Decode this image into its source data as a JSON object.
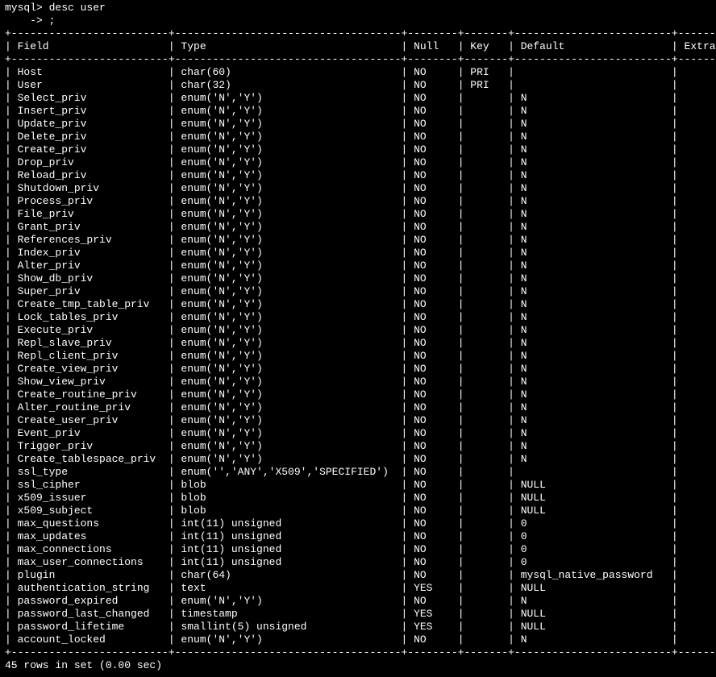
{
  "prompt1": "mysql> desc user",
  "prompt2": "    -> ;",
  "headers": [
    "Field",
    "Type",
    "Null",
    "Key",
    "Default",
    "Extra"
  ],
  "widths": [
    23,
    34,
    6,
    5,
    23,
    7
  ],
  "rows": [
    {
      "f": "Host",
      "t": "char(60)",
      "n": "NO",
      "k": "PRI",
      "d": "",
      "e": ""
    },
    {
      "f": "User",
      "t": "char(32)",
      "n": "NO",
      "k": "PRI",
      "d": "",
      "e": ""
    },
    {
      "f": "Select_priv",
      "t": "enum('N','Y')",
      "n": "NO",
      "k": "",
      "d": "N",
      "e": ""
    },
    {
      "f": "Insert_priv",
      "t": "enum('N','Y')",
      "n": "NO",
      "k": "",
      "d": "N",
      "e": ""
    },
    {
      "f": "Update_priv",
      "t": "enum('N','Y')",
      "n": "NO",
      "k": "",
      "d": "N",
      "e": ""
    },
    {
      "f": "Delete_priv",
      "t": "enum('N','Y')",
      "n": "NO",
      "k": "",
      "d": "N",
      "e": ""
    },
    {
      "f": "Create_priv",
      "t": "enum('N','Y')",
      "n": "NO",
      "k": "",
      "d": "N",
      "e": ""
    },
    {
      "f": "Drop_priv",
      "t": "enum('N','Y')",
      "n": "NO",
      "k": "",
      "d": "N",
      "e": ""
    },
    {
      "f": "Reload_priv",
      "t": "enum('N','Y')",
      "n": "NO",
      "k": "",
      "d": "N",
      "e": ""
    },
    {
      "f": "Shutdown_priv",
      "t": "enum('N','Y')",
      "n": "NO",
      "k": "",
      "d": "N",
      "e": ""
    },
    {
      "f": "Process_priv",
      "t": "enum('N','Y')",
      "n": "NO",
      "k": "",
      "d": "N",
      "e": ""
    },
    {
      "f": "File_priv",
      "t": "enum('N','Y')",
      "n": "NO",
      "k": "",
      "d": "N",
      "e": ""
    },
    {
      "f": "Grant_priv",
      "t": "enum('N','Y')",
      "n": "NO",
      "k": "",
      "d": "N",
      "e": ""
    },
    {
      "f": "References_priv",
      "t": "enum('N','Y')",
      "n": "NO",
      "k": "",
      "d": "N",
      "e": ""
    },
    {
      "f": "Index_priv",
      "t": "enum('N','Y')",
      "n": "NO",
      "k": "",
      "d": "N",
      "e": ""
    },
    {
      "f": "Alter_priv",
      "t": "enum('N','Y')",
      "n": "NO",
      "k": "",
      "d": "N",
      "e": ""
    },
    {
      "f": "Show_db_priv",
      "t": "enum('N','Y')",
      "n": "NO",
      "k": "",
      "d": "N",
      "e": ""
    },
    {
      "f": "Super_priv",
      "t": "enum('N','Y')",
      "n": "NO",
      "k": "",
      "d": "N",
      "e": ""
    },
    {
      "f": "Create_tmp_table_priv",
      "t": "enum('N','Y')",
      "n": "NO",
      "k": "",
      "d": "N",
      "e": ""
    },
    {
      "f": "Lock_tables_priv",
      "t": "enum('N','Y')",
      "n": "NO",
      "k": "",
      "d": "N",
      "e": ""
    },
    {
      "f": "Execute_priv",
      "t": "enum('N','Y')",
      "n": "NO",
      "k": "",
      "d": "N",
      "e": ""
    },
    {
      "f": "Repl_slave_priv",
      "t": "enum('N','Y')",
      "n": "NO",
      "k": "",
      "d": "N",
      "e": ""
    },
    {
      "f": "Repl_client_priv",
      "t": "enum('N','Y')",
      "n": "NO",
      "k": "",
      "d": "N",
      "e": ""
    },
    {
      "f": "Create_view_priv",
      "t": "enum('N','Y')",
      "n": "NO",
      "k": "",
      "d": "N",
      "e": ""
    },
    {
      "f": "Show_view_priv",
      "t": "enum('N','Y')",
      "n": "NO",
      "k": "",
      "d": "N",
      "e": ""
    },
    {
      "f": "Create_routine_priv",
      "t": "enum('N','Y')",
      "n": "NO",
      "k": "",
      "d": "N",
      "e": ""
    },
    {
      "f": "Alter_routine_priv",
      "t": "enum('N','Y')",
      "n": "NO",
      "k": "",
      "d": "N",
      "e": ""
    },
    {
      "f": "Create_user_priv",
      "t": "enum('N','Y')",
      "n": "NO",
      "k": "",
      "d": "N",
      "e": ""
    },
    {
      "f": "Event_priv",
      "t": "enum('N','Y')",
      "n": "NO",
      "k": "",
      "d": "N",
      "e": ""
    },
    {
      "f": "Trigger_priv",
      "t": "enum('N','Y')",
      "n": "NO",
      "k": "",
      "d": "N",
      "e": ""
    },
    {
      "f": "Create_tablespace_priv",
      "t": "enum('N','Y')",
      "n": "NO",
      "k": "",
      "d": "N",
      "e": ""
    },
    {
      "f": "ssl_type",
      "t": "enum('','ANY','X509','SPECIFIED')",
      "n": "NO",
      "k": "",
      "d": "",
      "e": ""
    },
    {
      "f": "ssl_cipher",
      "t": "blob",
      "n": "NO",
      "k": "",
      "d": "NULL",
      "e": ""
    },
    {
      "f": "x509_issuer",
      "t": "blob",
      "n": "NO",
      "k": "",
      "d": "NULL",
      "e": ""
    },
    {
      "f": "x509_subject",
      "t": "blob",
      "n": "NO",
      "k": "",
      "d": "NULL",
      "e": ""
    },
    {
      "f": "max_questions",
      "t": "int(11) unsigned",
      "n": "NO",
      "k": "",
      "d": "0",
      "e": ""
    },
    {
      "f": "max_updates",
      "t": "int(11) unsigned",
      "n": "NO",
      "k": "",
      "d": "0",
      "e": ""
    },
    {
      "f": "max_connections",
      "t": "int(11) unsigned",
      "n": "NO",
      "k": "",
      "d": "0",
      "e": ""
    },
    {
      "f": "max_user_connections",
      "t": "int(11) unsigned",
      "n": "NO",
      "k": "",
      "d": "0",
      "e": ""
    },
    {
      "f": "plugin",
      "t": "char(64)",
      "n": "NO",
      "k": "",
      "d": "mysql_native_password",
      "e": ""
    },
    {
      "f": "authentication_string",
      "t": "text",
      "n": "YES",
      "k": "",
      "d": "NULL",
      "e": ""
    },
    {
      "f": "password_expired",
      "t": "enum('N','Y')",
      "n": "NO",
      "k": "",
      "d": "N",
      "e": ""
    },
    {
      "f": "password_last_changed",
      "t": "timestamp",
      "n": "YES",
      "k": "",
      "d": "NULL",
      "e": ""
    },
    {
      "f": "password_lifetime",
      "t": "smallint(5) unsigned",
      "n": "YES",
      "k": "",
      "d": "NULL",
      "e": ""
    },
    {
      "f": "account_locked",
      "t": "enum('N','Y')",
      "n": "NO",
      "k": "",
      "d": "N",
      "e": ""
    }
  ],
  "footer": "45 rows in set (0.00 sec)"
}
